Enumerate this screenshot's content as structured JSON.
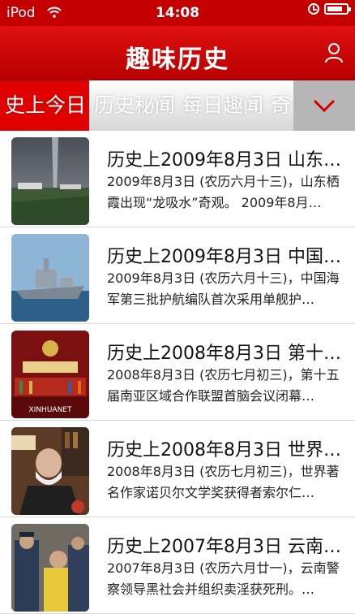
{
  "status_bar": {
    "carrier": "iPod",
    "time": "14:08",
    "battery_level": 0.8
  },
  "navbar": {
    "title": "趣味历史",
    "user_icon": "user-icon"
  },
  "tabs": [
    {
      "label": "史上今日",
      "active": true
    },
    {
      "label": "历史秘闻",
      "active": false
    },
    {
      "label": "每日趣闻",
      "active": false
    },
    {
      "label": "奇",
      "active": false
    }
  ],
  "tab_more_icon": "chevron-down-icon",
  "articles": [
    {
      "title": "历史上2009年8月3日 山东…",
      "desc": "2009年8月3日 (农历六月十三)，山东栖霞出现“龙吸水”奇观。 2009年8月…",
      "image": "waterspout-photo"
    },
    {
      "title": "历史上2009年8月3日 中国…",
      "desc": "2009年8月3日 (农历六月十三)，中国海军第三批护航编队首次采用单舰护…",
      "image": "warship-photo"
    },
    {
      "title": "历史上2008年8月3日 第十…",
      "desc": "2008年8月3日 (农历七月初三)，第十五届南亚区域合作联盟首脑会议闭幕…",
      "image": "summit-photo",
      "image_caption": "XINHUANET"
    },
    {
      "title": "历史上2008年8月3日 世界…",
      "desc": "2008年8月3日 (农历七月初三)，世界著名作家诺贝尔文学奖获得者索尔仁…",
      "image": "writer-photo"
    },
    {
      "title": "历史上2007年8月3日 云南…",
      "desc": "2007年8月3日 (农历六月廿一)，云南警察领导黑社会并组织卖淫获死刑。…",
      "image": "police-photo"
    }
  ]
}
